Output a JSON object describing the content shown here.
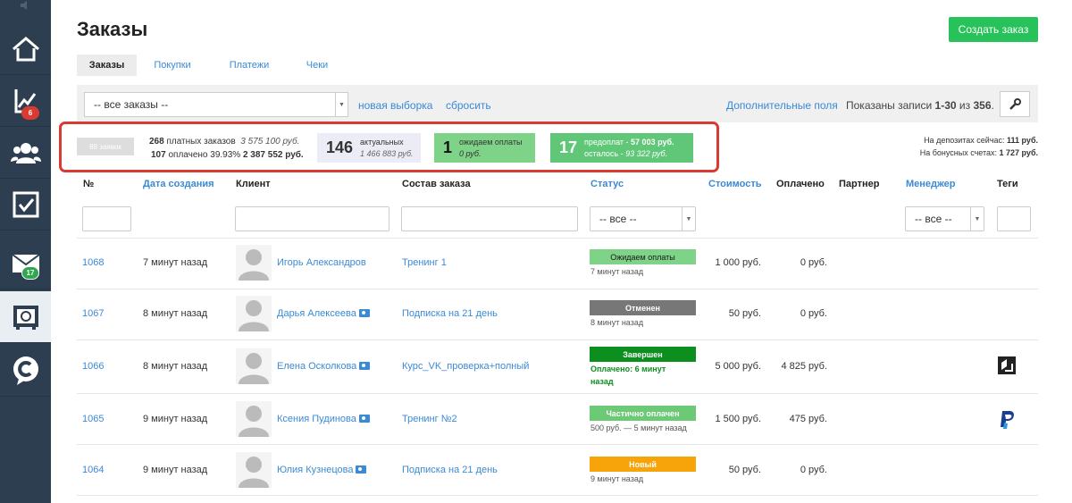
{
  "colors": {
    "sidebar_bg": "#2d3e50",
    "accent_link": "#3a8ad6",
    "create_button": "#27c25a",
    "status_waiting": "#7ed389",
    "status_cancelled": "#777777",
    "status_completed": "#0d8f20",
    "status_partial": "#6cc976",
    "status_new": "#f7a30a",
    "badge_red": "#d93b32",
    "badge_green": "#2fa84f",
    "highlight_frame": "#d93b32"
  },
  "sidebar": {
    "items": [
      {
        "icon": "home-icon"
      },
      {
        "icon": "chart-icon",
        "badge": "6"
      },
      {
        "icon": "users-icon"
      },
      {
        "icon": "checkbox-icon"
      },
      {
        "icon": "mail-icon",
        "badge": "17"
      },
      {
        "icon": "safe-icon"
      },
      {
        "icon": "chat-logo-icon"
      }
    ]
  },
  "header": {
    "title": "Заказы",
    "create_button": "Создать заказ"
  },
  "tabs": [
    {
      "label": "Заказы",
      "active": true
    },
    {
      "label": "Покупки"
    },
    {
      "label": "Платежи"
    },
    {
      "label": "Чеки"
    }
  ],
  "filter": {
    "select_value": "-- все заказы --",
    "new_selection": "новая выборка",
    "reset": "сбросить",
    "extra_fields": "Дополнительные поля",
    "shown_prefix": "Показаны записи",
    "shown_range": "1-30",
    "shown_of": "из",
    "shown_total": "356",
    "shown_suffix": "."
  },
  "stats": {
    "orders_count_label": "88 заявок",
    "paid_orders_count": "268",
    "paid_orders_label": "платных заказов",
    "paid_orders_sum": "3 575 100 руб.",
    "paid_count": "107",
    "paid_label": "оплачено 39.93%",
    "paid_sum": "2 387 552 руб.",
    "actual_count": "146",
    "actual_label": "актуальных",
    "actual_sum": "1 466 883 руб.",
    "waiting_count": "1",
    "waiting_label": "ожидаем оплаты",
    "waiting_sum": "0 руб.",
    "prepay_count": "17",
    "prepay_label": "предоплат -",
    "prepay_sum": "57 003 руб.",
    "remaining_label": "осталось -",
    "remaining_sum": "93 322 руб.",
    "deposits_label": "На депозитах сейчас:",
    "deposits_value": "111 руб.",
    "bonus_label": "На бонусных счетах:",
    "bonus_value": "1 727 руб."
  },
  "table": {
    "headers": {
      "number": "№",
      "created": "Дата создания",
      "client": "Клиент",
      "composition": "Состав заказа",
      "status": "Статус",
      "cost": "Стоимость",
      "paid": "Оплачено",
      "partner": "Партнер",
      "manager": "Менеджер",
      "tags": "Теги"
    },
    "status_filter": "-- все --",
    "manager_filter": "-- все --",
    "rows": [
      {
        "id": "1068",
        "created": "7 минут назад",
        "client": "Игорь Александров",
        "client_card": false,
        "composition": "Тренинг 1",
        "status": "Ожидаем оплаты",
        "status_color": "#7ed389",
        "status_note": "7 минут назад",
        "cost": "1 000 руб.",
        "paid": "0 руб.",
        "tag": ""
      },
      {
        "id": "1067",
        "created": "8 минут назад",
        "client": "Дарья Алексеева",
        "client_card": true,
        "composition": "Подписка на 21 день",
        "status": "Отменен",
        "status_color": "#777777",
        "status_note": "8 минут назад",
        "cost": "50 руб.",
        "paid": "0 руб.",
        "tag": ""
      },
      {
        "id": "1066",
        "created": "8 минут назад",
        "client": "Елена Осколкова",
        "client_card": true,
        "composition": "Курс_VK_проверка+полный",
        "status": "Завершен",
        "status_color": "#0d8f20",
        "status_note_line1": "Оплачено: 6 минут",
        "status_note_line2": "назад",
        "cost": "5 000 руб.",
        "paid": "4 825 руб.",
        "tag": "payment-tag-icon"
      },
      {
        "id": "1065",
        "created": "9 минут назад",
        "client": "Ксения Пудинова",
        "client_card": true,
        "composition": "Тренинг №2",
        "status": "Частично оплачен",
        "status_color": "#6cc976",
        "status_note": "500 руб. — 5 минут назад",
        "cost": "1 500 руб.",
        "paid": "475 руб.",
        "tag": "paypal-icon"
      },
      {
        "id": "1064",
        "created": "9 минут назад",
        "client": "Юлия Кузнецова",
        "client_card": true,
        "composition": "Подписка на 21 день",
        "status": "Новый",
        "status_color": "#f7a30a",
        "status_note": "9 минут назад",
        "cost": "50 руб.",
        "paid": "0 руб.",
        "tag": ""
      }
    ]
  }
}
